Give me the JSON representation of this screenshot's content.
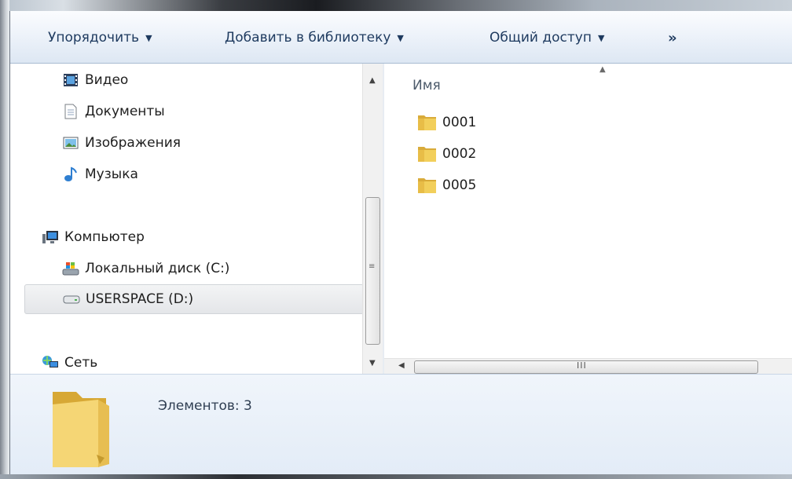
{
  "toolbar": {
    "organize": "Упорядочить",
    "add_to_library": "Добавить в библиотеку",
    "share": "Общий доступ",
    "more": "»"
  },
  "nav": {
    "libraries": [
      {
        "label": "Видео",
        "icon": "video-library-icon"
      },
      {
        "label": "Документы",
        "icon": "documents-library-icon"
      },
      {
        "label": "Изображения",
        "icon": "pictures-library-icon"
      },
      {
        "label": "Музыка",
        "icon": "music-library-icon"
      }
    ],
    "computer": {
      "label": "Компьютер",
      "icon": "computer-icon"
    },
    "drives": [
      {
        "label": "Локальный диск (C:)",
        "icon": "system-drive-icon",
        "selected": false
      },
      {
        "label": "USERSPACE (D:)",
        "icon": "hard-drive-icon",
        "selected": true
      }
    ],
    "network": {
      "label": "Сеть",
      "icon": "network-icon"
    }
  },
  "content": {
    "column_header": "Имя",
    "files": [
      {
        "name": "0001",
        "icon": "folder-icon"
      },
      {
        "name": "0002",
        "icon": "folder-icon"
      },
      {
        "name": "0005",
        "icon": "folder-icon"
      }
    ],
    "hscroll_grip": "III"
  },
  "details": {
    "count_text": "Элементов: 3",
    "icon": "large-folder-icon"
  },
  "colors": {
    "toolbar_text": "#1e3a5f",
    "folder": "#f2cf5b",
    "details_bg": "#e9f0f9"
  }
}
